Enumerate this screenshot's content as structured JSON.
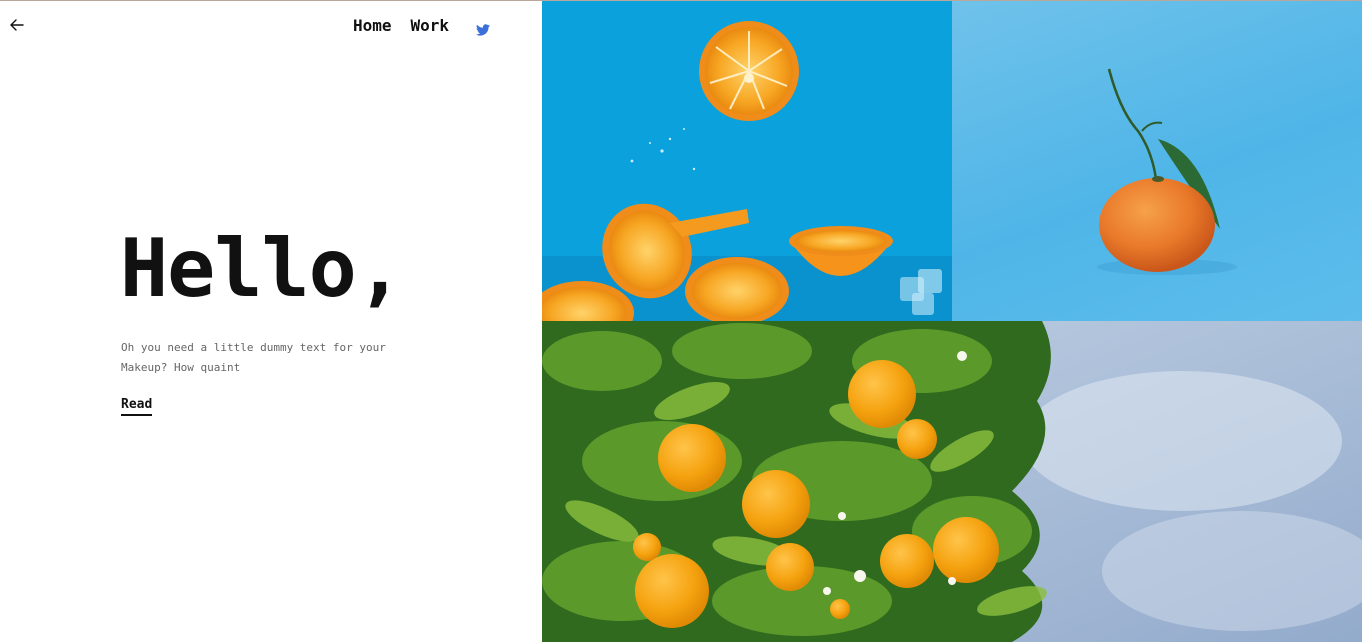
{
  "header": {
    "back_icon": "arrow-left-icon",
    "nav": [
      {
        "label": "Home"
      },
      {
        "label": "Work"
      }
    ],
    "twitter_icon": "twitter-icon",
    "twitter_color": "#3b6fd9"
  },
  "hero": {
    "title": "Hello,",
    "body": "Oh you need a little dummy text for your Makeup? How quaint",
    "cta": "Read"
  },
  "gallery": {
    "images": [
      {
        "name": "orange-slices-photo",
        "bg": "#0aa1dc"
      },
      {
        "name": "tangerine-photo",
        "bg": "#5cbdeb"
      },
      {
        "name": "orange-tree-photo",
        "bg": "#b8c8de"
      }
    ]
  }
}
